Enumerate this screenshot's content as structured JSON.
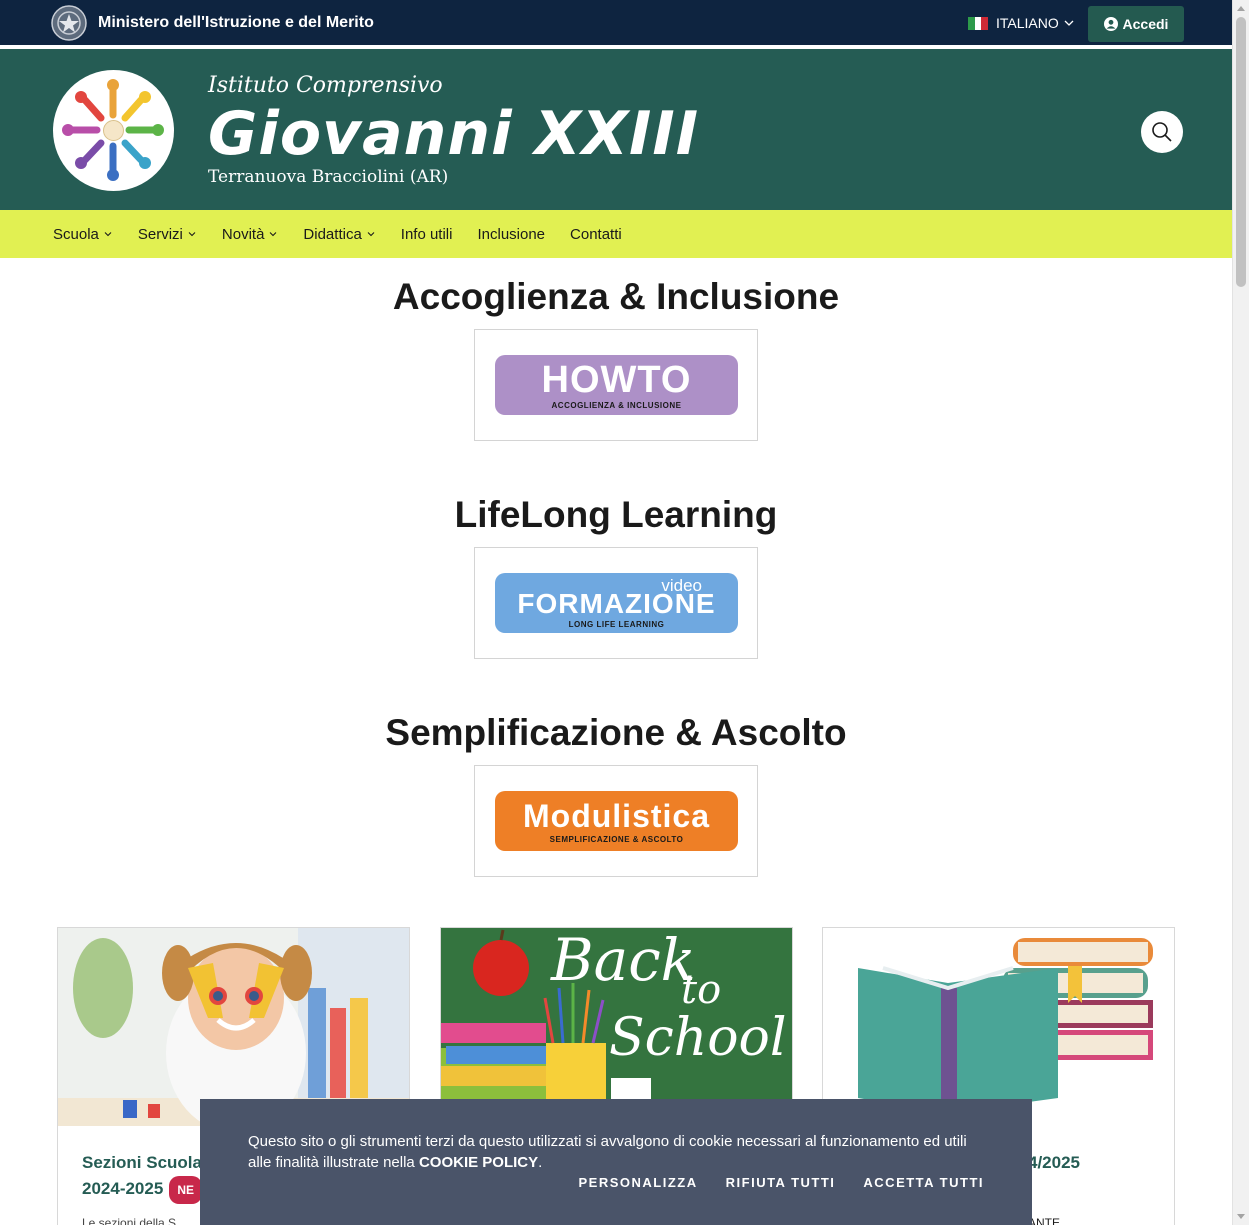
{
  "topbar": {
    "ministry": "Ministero dell'Istruzione e del Merito",
    "language": "ITALIANO",
    "login": "Accedi"
  },
  "header": {
    "subtitle_top": "Istituto Comprensivo",
    "school_name": "Giovanni XXIII",
    "subtitle_bottom": "Terranuova Bracciolini (AR)"
  },
  "nav": {
    "items": [
      {
        "label": "Scuola",
        "dropdown": true
      },
      {
        "label": "Servizi",
        "dropdown": true
      },
      {
        "label": "Novità",
        "dropdown": true
      },
      {
        "label": "Didattica",
        "dropdown": true
      },
      {
        "label": "Info utili",
        "dropdown": false
      },
      {
        "label": "Inclusione",
        "dropdown": false
      },
      {
        "label": "Contatti",
        "dropdown": false
      }
    ]
  },
  "sections": [
    {
      "title": "Accoglienza & Inclusione",
      "banner_big": "HOWTO",
      "banner_small": "ACCOGLIENZA & INCLUSIONE"
    },
    {
      "title": "LifeLong Learning",
      "banner_big": "FORMAZIONE",
      "banner_small": "LONG LIFE LEARNING",
      "banner_extra": "video"
    },
    {
      "title": "Semplificazione & Ascolto",
      "banner_big": "Modulistica",
      "banner_small": "SEMPLIFICAZIONE & ASCOLTO"
    }
  ],
  "cards": [
    {
      "title_line1": "Sezioni Scuola i",
      "title_line2": "2024-2025",
      "badge": "NE",
      "text": "Le sezioni della S"
    },
    {
      "image_text_1": "Back",
      "image_text_2": "to",
      "image_text_3": "School"
    },
    {
      "title_right": "4/2025",
      "text": "ANTE"
    }
  ],
  "cookie": {
    "message": "Questo sito o gli strumenti terzi da questo utilizzati si avvalgono di cookie necessari al funzionamento ed utili alle finalità illustrate nella ",
    "policy_link": "COOKIE POLICY",
    "after": ".",
    "customize": "PERSONALIZZA",
    "reject": "RIFIUTA TUTTI",
    "accept": "ACCETTA TUTTI"
  },
  "colors": {
    "topbar": "#0e2440",
    "header": "#255c54",
    "nav": "#e1f052",
    "howto": "#ad90c7",
    "formazione": "#6fa8e0",
    "modulistica": "#ee7f26",
    "cookie": "#4a5469",
    "badge": "#c8284a"
  }
}
